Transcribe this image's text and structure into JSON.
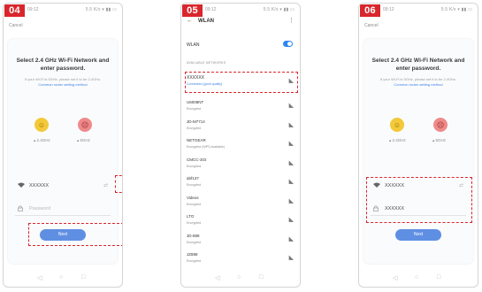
{
  "steps": {
    "step1": {
      "badge": "04",
      "cancel": "Cancel",
      "title": "Select 2.4 GHz Wi-Fi Network and enter password.",
      "subtitle": "If your Wi-Fi is 5GHz, please set it to be 2.4GHz.",
      "subtitle_link": "Common router setting method",
      "band_24": "2.4GHz",
      "band_5": "5GHz",
      "wifi_name": "XXXXXX",
      "password_placeholder": "Password",
      "next": "Next"
    },
    "step2": {
      "badge": "05",
      "title": "WLAN",
      "wlan_toggle_label": "WLAN",
      "list_header": "AVAILABLE NETWORKS",
      "selected_network": "XXXXXX",
      "selected_network_sub": "Connected (good quality)",
      "networks": [
        {
          "name": "U6008NT",
          "sub": "Encrypted"
        },
        {
          "name": "JD-M7714",
          "sub": "Encrypted"
        },
        {
          "name": "NETGEAR",
          "sub": "Encrypted (WPS available)"
        },
        {
          "name": "CMCC-3Gt",
          "sub": "Encrypted"
        },
        {
          "name": "abf137",
          "sub": "Encrypted"
        },
        {
          "name": "Videos",
          "sub": "Encrypted"
        },
        {
          "name": "LTO",
          "sub": "Encrypted"
        },
        {
          "name": "JD-888",
          "sub": "Encrypted"
        },
        {
          "name": "JZ888",
          "sub": "Encrypted"
        }
      ]
    },
    "step3": {
      "badge": "06",
      "cancel": "Cancel",
      "title": "Select 2.4 GHz Wi-Fi Network and enter password.",
      "subtitle": "If your Wi-Fi is 5GHz, please set it to be 2.4GHz.",
      "subtitle_link": "Common router setting method",
      "band_24": "2.4GHz",
      "band_5": "5GHz",
      "wifi_name": "XXXXXX",
      "password_value": "XXXXXX",
      "next": "Next"
    }
  },
  "status_bar": {
    "time": "09:12",
    "icons": "5.5 K/s ▾ ▮▮ ▭"
  },
  "nav": {
    "back": "◁",
    "home": "○",
    "recent": "□"
  },
  "icons": {
    "wifi": "wifi-icon",
    "lock": "lock-icon",
    "signal": "wifi-signal-icon",
    "toggle": "toggle-switch"
  },
  "colors": {
    "badge": "#d9262c",
    "highlight_border": "#d9262c",
    "button": "#5f8fe3",
    "toggle_on": "#2e86f0",
    "link": "#3d7fe4"
  }
}
